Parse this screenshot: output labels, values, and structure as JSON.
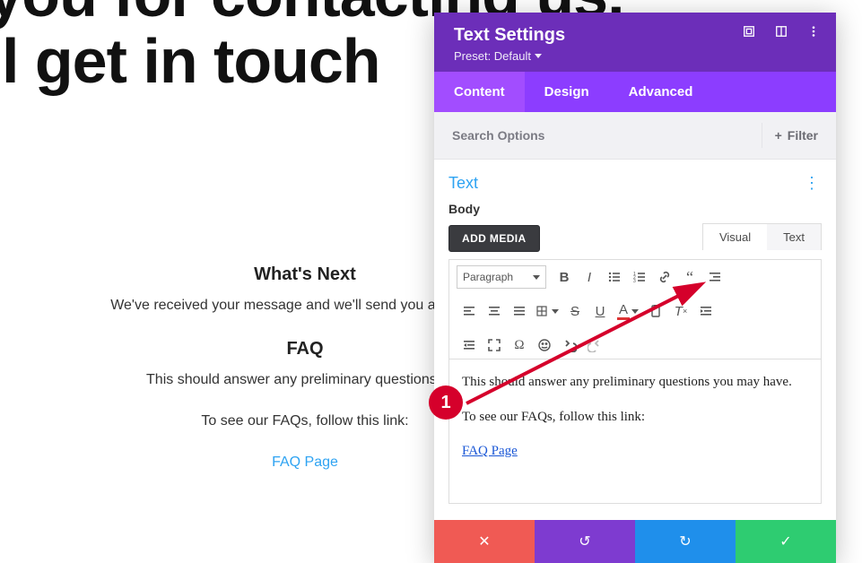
{
  "page": {
    "headline_line1": "k you for contacting us.",
    "headline_line2": "e'll get in touch",
    "whats_next_heading": "What's Next",
    "whats_next_body": "We've received your message and we'll send you an email wi",
    "faq_heading": "FAQ",
    "faq_body": "This should answer any preliminary questions you",
    "faq_follow": "To see our FAQs, follow this link:",
    "faq_link_label": "FAQ Page"
  },
  "annotation": {
    "number": "1"
  },
  "panel": {
    "title": "Text Settings",
    "preset_label": "Preset: Default",
    "tabs": {
      "content": "Content",
      "design": "Design",
      "advanced": "Advanced"
    },
    "search_placeholder": "Search Options",
    "filter_label": "Filter",
    "section_title": "Text",
    "body_label": "Body",
    "add_media": "ADD MEDIA",
    "editor_tabs": {
      "visual": "Visual",
      "text": "Text"
    },
    "paragraph_select": "Paragraph",
    "content": {
      "p1": "This should answer any preliminary questions you may have.",
      "p2": "To see our FAQs, follow this link:",
      "link_text": "FAQ Page"
    }
  }
}
